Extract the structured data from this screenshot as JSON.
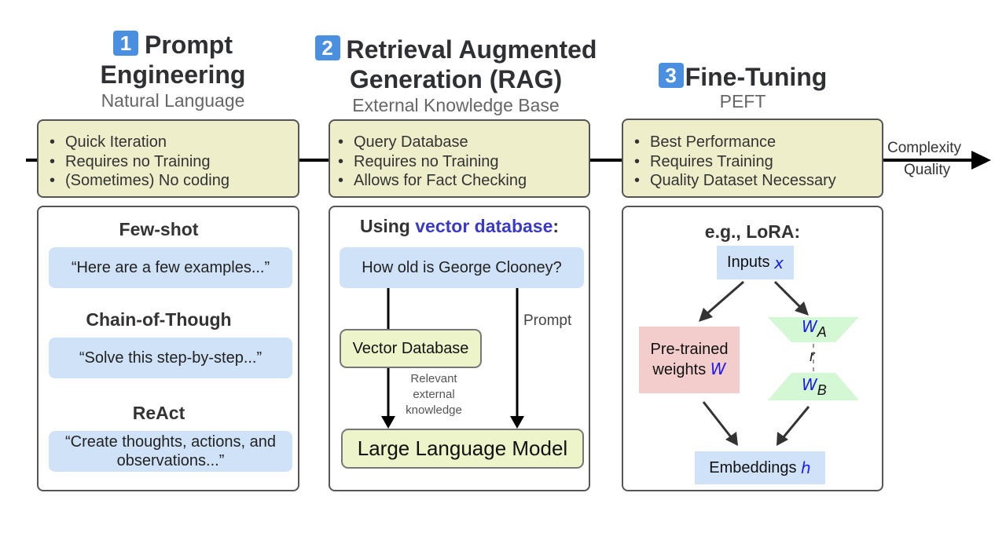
{
  "colors": {
    "badge": "#4a8fe0",
    "feature_box": "#efeecb",
    "quote_box": "#cfe2f7",
    "llm_node": "#eef4c9",
    "pretrained": "#f3cdcc",
    "adapter": "#d4f7d4",
    "highlight_text": "#3a3ac8",
    "variable_text": "#1a1af0"
  },
  "axis": {
    "label_top": "Complexity",
    "label_bottom": "Quality"
  },
  "columns": [
    {
      "number": "1",
      "title_line1": "Prompt",
      "title_line2": "Engineering",
      "subtitle": "Natural Language",
      "features": [
        "Quick Iteration",
        "Requires no Training",
        "(Sometimes) No coding"
      ],
      "panel": {
        "sections": [
          {
            "heading": "Few-shot",
            "example": "“Here are a few examples...”"
          },
          {
            "heading": "Chain-of-Though",
            "example": "“Solve this step-by-step...”"
          },
          {
            "heading": "ReAct",
            "example_line1": "“Create thoughts, actions, and",
            "example_line2": "observations...”"
          }
        ]
      }
    },
    {
      "number": "2",
      "title_line1": "Retrieval Augmented",
      "title_line2": "Generation (RAG)",
      "subtitle": "External Knowledge Base",
      "features": [
        "Query Database",
        "Requires no Training",
        "Allows for Fact Checking"
      ],
      "panel": {
        "heading_prefix": "Using ",
        "heading_highlight": "vector database",
        "heading_suffix": ":",
        "query": "How old is George Clooney?",
        "prompt_label": "Prompt",
        "vector_db": "Vector Database",
        "retrieval_label_line1": "Relevant",
        "retrieval_label_line2": "external",
        "retrieval_label_line3": "knowledge",
        "llm": "Large Language Model"
      }
    },
    {
      "number": "3",
      "title_line1": "Fine-Tuning",
      "subtitle": "PEFT",
      "features": [
        "Best Performance",
        "Requires Training",
        "Quality Dataset Necessary"
      ],
      "panel": {
        "heading": "e.g., LoRA:",
        "inputs_label": "Inputs",
        "inputs_var": "x",
        "pretrained_line1": "Pre-trained",
        "pretrained_line2": "weights",
        "pretrained_var": "W",
        "adapter_a_var": "W",
        "adapter_a_sub": "A",
        "rank_label": "r",
        "adapter_b_var": "W",
        "adapter_b_sub": "B",
        "output_label": "Embeddings",
        "output_var": "h"
      }
    }
  ]
}
